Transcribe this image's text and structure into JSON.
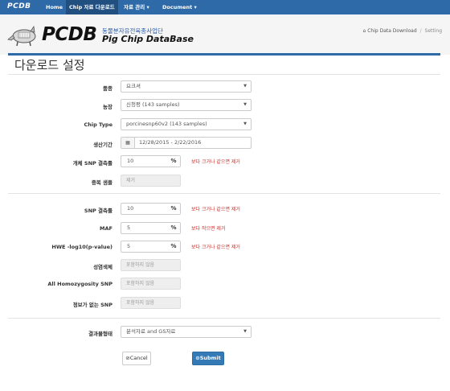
{
  "nav": {
    "brand": "PCDB",
    "items": [
      {
        "label": "Home",
        "active": false
      },
      {
        "label": "Chip 자료 다운로드",
        "active": true
      },
      {
        "label": "자료 관리 ▾",
        "active": false
      },
      {
        "label": "Document ▾",
        "active": false
      }
    ]
  },
  "header": {
    "logo_title": "PCDB",
    "logo_kor": "동물분자유전육종사업단",
    "logo_sub": "Pig Chip DataBase",
    "breadcrumb": {
      "home_icon": "home-icon",
      "item1": "Chip Data Download",
      "separator": "/",
      "item2": "Setting"
    }
  },
  "page": {
    "title": "다운로드 설정"
  },
  "form": {
    "breed": {
      "label": "품종",
      "value": "요크셔"
    },
    "farm": {
      "label": "농장",
      "value": "신청평 (143 samples)"
    },
    "chip_type": {
      "label": "Chip Type",
      "value": "porcinesnp60v2 (143 samples)"
    },
    "production_period": {
      "label": "생산기간",
      "value": "12/28/2015 - 2/22/2016",
      "icon": "calendar-icon"
    },
    "individual_snp_missing": {
      "label": "개체 SNP 결측률",
      "value": "10",
      "unit": "%",
      "hint": "보다 크거나 같으면 제거"
    },
    "duplicate_sample": {
      "label": "중복 샘플",
      "value": "제거"
    },
    "snp_missing": {
      "label": "SNP 결측률",
      "value": "10",
      "unit": "%",
      "hint": "보다 크거나 같으면 제거"
    },
    "maf": {
      "label": "MAF",
      "value": "5",
      "unit": "%",
      "hint": "보다 작으면 제거"
    },
    "hwe": {
      "label": "HWE -log10(p-value)",
      "value": "5",
      "unit": "%",
      "hint": "보다 크거나 같으면 제거"
    },
    "sex_chromosome": {
      "label": "성염색체",
      "value": "포함하지 않음"
    },
    "all_homozygosity": {
      "label": "All Homozygosity SNP",
      "value": "포함하지 않음"
    },
    "no_info_snp": {
      "label": "정보가 없는 SNP",
      "value": "포함하지 않음"
    },
    "result_format": {
      "label": "결과물형태",
      "value": "분석자료 and GS자료"
    }
  },
  "buttons": {
    "cancel": "Cancel",
    "submit": "Submit"
  }
}
